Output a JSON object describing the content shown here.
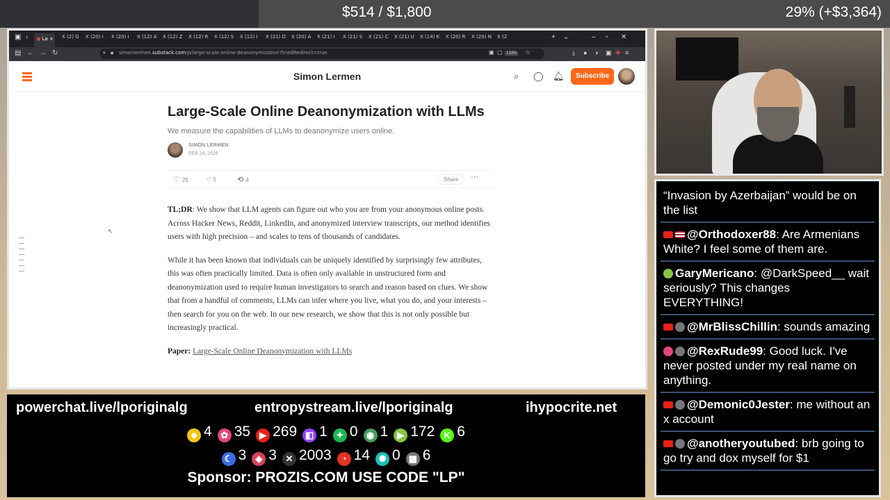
{
  "topbar": {
    "goal": "$514 / $1,800",
    "percent": "29% (+$3,364)"
  },
  "browser": {
    "tabs": [
      {
        "label": "La",
        "active": true
      },
      {
        "label": "(2) G"
      },
      {
        "label": "(20) I"
      },
      {
        "label": "(20) I"
      },
      {
        "label": "(12) A"
      },
      {
        "label": "(12) Z"
      },
      {
        "label": "(12) R"
      },
      {
        "label": "(12) S"
      },
      {
        "label": "(12) I"
      },
      {
        "label": "(21) D"
      },
      {
        "label": "(20) A"
      },
      {
        "label": "(21) I"
      },
      {
        "label": "(21) S"
      },
      {
        "label": "(21) C"
      },
      {
        "label": "(21) U"
      },
      {
        "label": "(14) K"
      },
      {
        "label": "(20) R"
      },
      {
        "label": "(20) N"
      },
      {
        "label": "(2"
      }
    ],
    "url_prefix": "simonlermen.",
    "url_domain": "substack.com",
    "url_path": "/p/large-scale-online-deanonymization?triedRedirect=true",
    "zoom": "133%"
  },
  "site": {
    "title": "Simon Lermen",
    "subscribe": "Subscribe"
  },
  "post": {
    "title": "Large-Scale Online Deanonymization with LLMs",
    "subtitle": "We measure the capabilities of LLMs to deanonymize users online.",
    "author": "SIMON LERMEN",
    "date": "FEB 24, 2026",
    "likes": "25",
    "comments": "5",
    "restacks": "4",
    "share": "Share",
    "tldr_label": "TL;DR",
    "tldr": ": We show that LLM agents can figure out who you are from your anonymous online posts. Across Hacker News, Reddit, LinkedIn, and anonymized interview transcripts, our method identifies users with high precision – and scales to tens of thousands of candidates.",
    "para2": "While it has been known that individuals can be uniquely identified by surprisingly few attributes, this was often practically limited. Data is often only available in unstructured form and deanonymization used to require human investigators to search and reason based on clues. We show that from a handful of comments, LLMs can infer where you live, what you do, and your interests – then search for you on the web. In our new research, we show that this is not only possible but increasingly practical.",
    "paper_label": "Paper:",
    "paper_link": "Large-Scale Online Deanonymization with LLMs"
  },
  "bottom": {
    "url1": "powerchat.live/lporiginalg",
    "url2": "entropystream.live/lporiginalg",
    "url3": "ihypocrite.net",
    "counts_row1": [
      {
        "icon": "rumble-icon",
        "color": "#f3c414",
        "value": "4"
      },
      {
        "icon": "pinwheel-icon",
        "color": "#e2467c",
        "value": "35"
      },
      {
        "icon": "youtube-icon",
        "color": "#e62117",
        "value": "269"
      },
      {
        "icon": "twitch-icon",
        "color": "#9146ff",
        "value": "1"
      },
      {
        "icon": "trovo-icon",
        "color": "#1db954",
        "value": "0"
      },
      {
        "icon": "globe-icon",
        "color": "#4a9d5c",
        "value": "1"
      },
      {
        "icon": "play-icon",
        "color": "#85c742",
        "value": "172"
      },
      {
        "icon": "kick-icon",
        "color": "#53fc18",
        "value": "6"
      }
    ],
    "counts_row2": [
      {
        "icon": "moon-icon",
        "color": "#3a6ee8",
        "value": "3"
      },
      {
        "icon": "pill-icon",
        "color": "#d8435a",
        "value": "3"
      },
      {
        "icon": "x-icon",
        "color": "#333333",
        "value": "2003"
      },
      {
        "icon": "ring-icon",
        "color": "#e23222",
        "value": "14"
      },
      {
        "icon": "fan-icon",
        "color": "#18c0b6",
        "value": "0"
      },
      {
        "icon": "grid-icon",
        "color": "#777777",
        "value": "6"
      }
    ],
    "sponsor": "Sponsor: PROZIS.COM USE CODE \"LP\""
  },
  "chat": [
    {
      "user": "",
      "text": "“Invasion by Azerbaijan” would be on the list",
      "badge": "none"
    },
    {
      "user": "@Orthodoxer88",
      "text": ": Are Armenians White? I feel some of them are.",
      "badge": "youtube-flag"
    },
    {
      "user": "GaryMericano",
      "text": ": @DarkSpeed__ wait seriously? This changes EVERYTHING!",
      "badge": "rumble"
    },
    {
      "user": "@MrBlissChillin",
      "text": ": sounds amazing",
      "badge": "youtube-avatar"
    },
    {
      "user": "@RexRude99",
      "text": ": Good luck. I've never posted under my real name on anything.",
      "badge": "pinwheel-avatar"
    },
    {
      "user": "@Demonic0Jester",
      "text": ": me without an x account",
      "badge": "youtube-avatar"
    },
    {
      "user": "@anotheryoutubed",
      "text": ": brb going to go try and dox myself for $1",
      "badge": "youtube-avatar"
    }
  ]
}
